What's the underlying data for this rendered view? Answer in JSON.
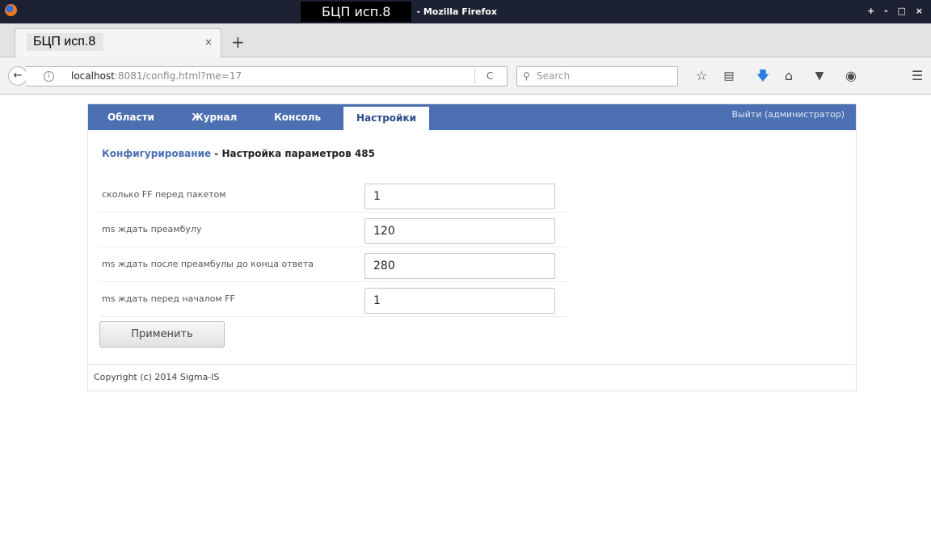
{
  "titlebar": {
    "page_title": "БЦП исп.8",
    "app_suffix": "- Mozilla Firefox",
    "controls": "+ - □ ×"
  },
  "tab": {
    "label": "БЦП исп.8",
    "close": "×",
    "new_tab": "+"
  },
  "navbar": {
    "back": "←",
    "url_host": "localhost",
    "url_rest": ":8081/config.html?me=17",
    "reload": "C",
    "search_placeholder": "Search",
    "icons": [
      "star-icon",
      "bookmarks-icon",
      "download-icon",
      "home-icon",
      "pocket-icon",
      "sync-icon",
      "menu-icon"
    ]
  },
  "menu": {
    "items": [
      "Области",
      "Журнал",
      "Консоль",
      "Настройки"
    ],
    "active": "Настройки",
    "logout": "Выйти (администратор)"
  },
  "breadcrumb": {
    "link": "Конфигурирование",
    "separator": " - ",
    "current": "Настройка параметров 485"
  },
  "form": {
    "fields": [
      {
        "label": "сколько FF перед пакетом",
        "value": "1"
      },
      {
        "label": "ms ждать преамбулу",
        "value": "120"
      },
      {
        "label": "ms ждать после преамбулы до конца ответа",
        "value": "280"
      },
      {
        "label": "ms ждать перед началом FF",
        "value": "1"
      }
    ],
    "apply_label": "Применить"
  },
  "footer": {
    "copyright": "Copyright (c) 2014 Sigma-IS"
  },
  "colors": {
    "menu_bar": "#4c70b1",
    "titlebar": "#1d2233",
    "link": "#4c70b1",
    "download_icon": "#2a7de1"
  }
}
